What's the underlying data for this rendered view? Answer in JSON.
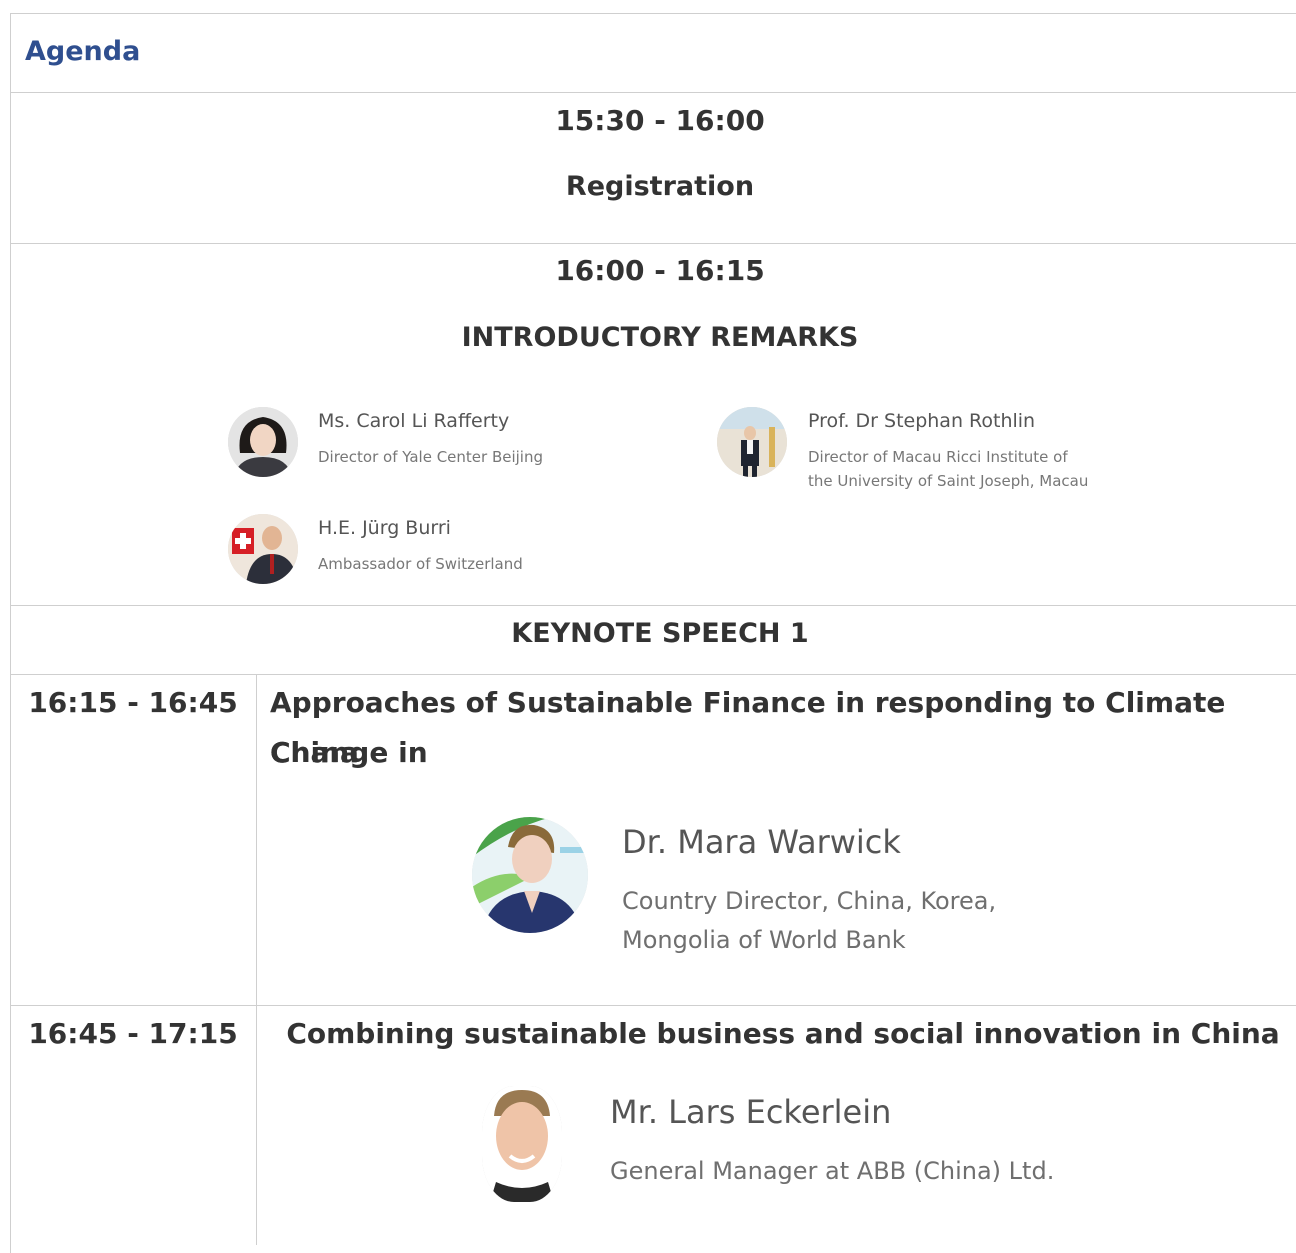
{
  "agenda": {
    "title": "Agenda"
  },
  "block1": {
    "time": "15:30 - 16:00",
    "heading": "Registration"
  },
  "block2": {
    "time": "16:00 - 16:15",
    "heading": "INTRODUCTORY REMARKS",
    "speakers": [
      {
        "name": "Ms. Carol Li Rafferty",
        "role": "Director of Yale Center Beijing"
      },
      {
        "name": "Prof. Dr Stephan Rothlin",
        "role_line1": "Director of Macau Ricci Institute of",
        "role_line2": "the University of Saint Joseph, Macau"
      },
      {
        "name": "H.E. Jürg Burri",
        "role": "Ambassador of Switzerland"
      }
    ]
  },
  "keynote": {
    "heading": "KEYNOTE SPEECH 1"
  },
  "sessions": [
    {
      "time": "16:15 - 16:45",
      "title_line1": "Approaches of Sustainable Finance in responding to Climate Change in",
      "title_line2": "China",
      "speaker": {
        "name": "Dr. Mara Warwick",
        "role_line1": "Country Director, China, Korea,",
        "role_line2": "Mongolia of World Bank"
      }
    },
    {
      "time": "16:45 - 17:15",
      "title": "Combining sustainable business and social innovation in China",
      "speaker": {
        "name": "Mr. Lars Eckerlein",
        "role": "General Manager at ABB (China) Ltd."
      }
    }
  ],
  "colors": {
    "agenda_title": "#2f4f8f",
    "border": "#cfcfcf",
    "text": "#333333"
  },
  "icons": [
    "carol-avatar",
    "stephan-avatar",
    "jurg-avatar",
    "mara-avatar",
    "lars-avatar"
  ]
}
